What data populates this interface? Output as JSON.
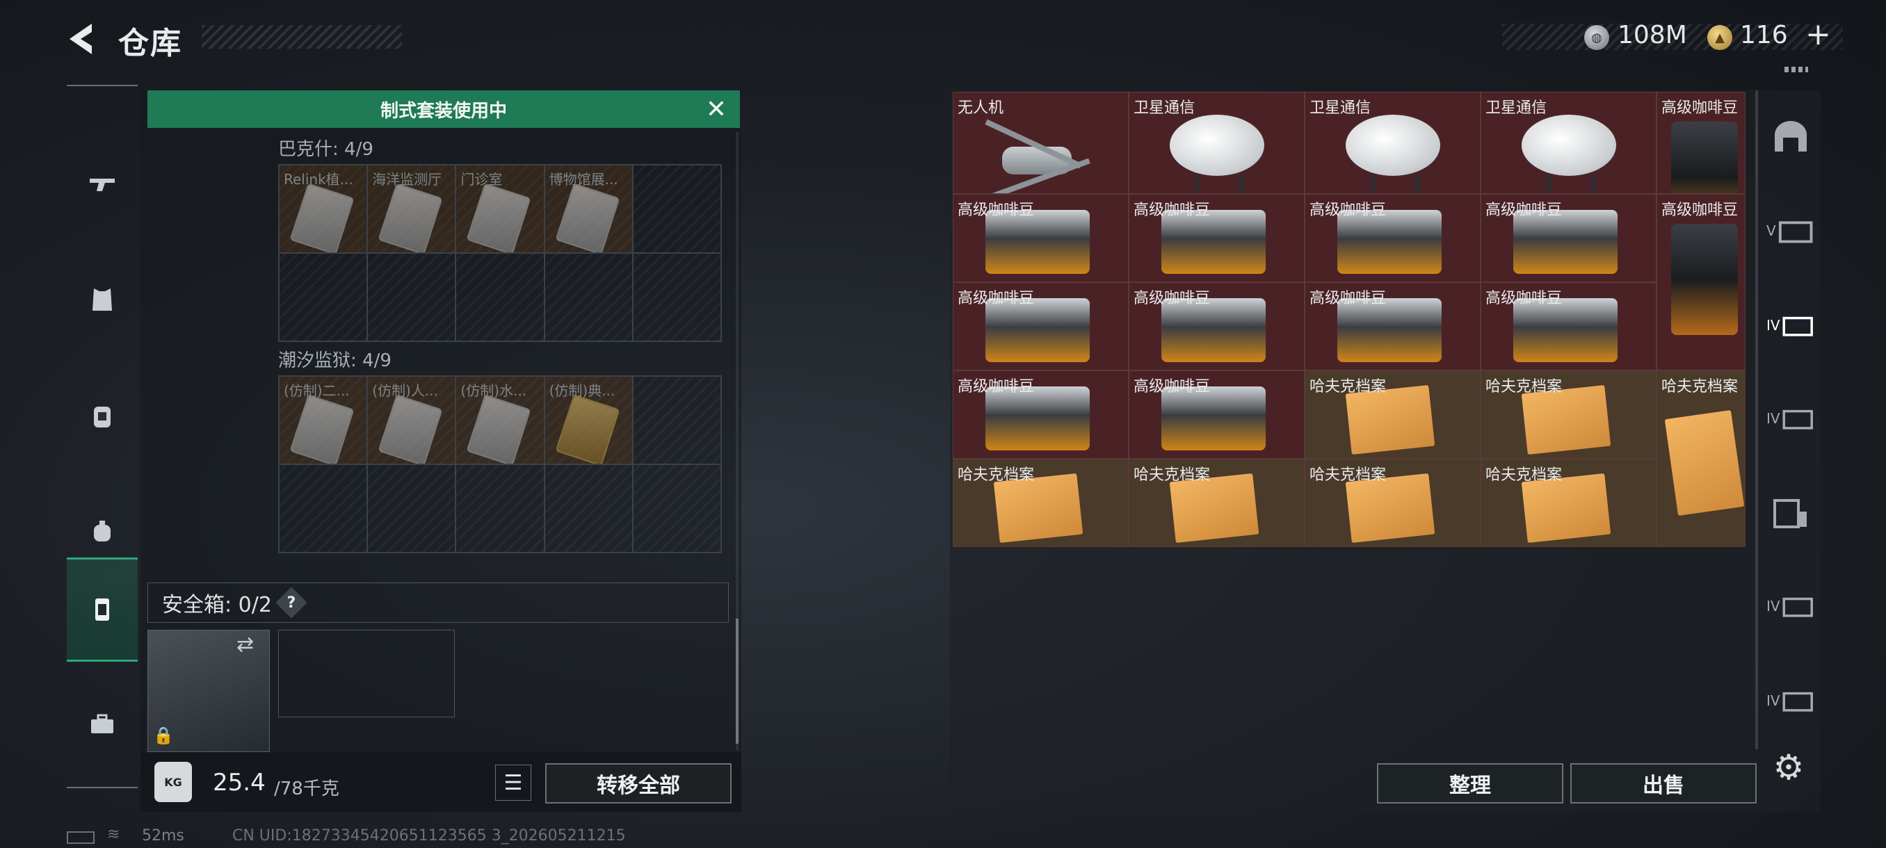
{
  "header": {
    "title": "仓库",
    "coin_value": "108M",
    "token_value": "116",
    "token_plus": "+"
  },
  "banner": {
    "text": "制式套装使用中"
  },
  "sets": [
    {
      "title": "巴克什: 4/9",
      "items": [
        "Relink植...",
        "海洋监测厅",
        "门诊室",
        "博物馆展..."
      ]
    },
    {
      "title": "潮汐监狱: 4/9",
      "items": [
        "(仿制)二...",
        "(仿制)人...",
        "(仿制)水...",
        "(仿制)典..."
      ]
    }
  ],
  "safe_box": {
    "label": "安全箱: 0/2",
    "help": "?"
  },
  "weight": {
    "icon": "KG",
    "current": "25.4",
    "max": "/78千克"
  },
  "buttons": {
    "transfer_all": "转移全部",
    "sort": "整理",
    "sell": "出售"
  },
  "stash_items": [
    {
      "name": "无人机",
      "art": "drone",
      "bg": "red"
    },
    {
      "name": "卫星通信",
      "art": "dish",
      "bg": "red"
    },
    {
      "name": "卫星通信",
      "art": "dish",
      "bg": "red"
    },
    {
      "name": "卫星通信",
      "art": "dish",
      "bg": "red"
    },
    {
      "name": "高级咖啡豆",
      "art": "bag-tall",
      "bg": "red"
    },
    {
      "name": "高级咖啡豆",
      "art": "bag-wide",
      "bg": "red"
    },
    {
      "name": "高级咖啡豆",
      "art": "bag-wide",
      "bg": "red"
    },
    {
      "name": "高级咖啡豆",
      "art": "bag-wide",
      "bg": "red"
    },
    {
      "name": "高级咖啡豆",
      "art": "bag-wide",
      "bg": "red"
    },
    {
      "name": "高级咖啡豆",
      "art": "bag-tall",
      "bg": "red"
    },
    {
      "name": "高级咖啡豆",
      "art": "bag-wide",
      "bg": "red"
    },
    {
      "name": "高级咖啡豆",
      "art": "bag-wide",
      "bg": "red"
    },
    {
      "name": "高级咖啡豆",
      "art": "bag-wide",
      "bg": "red"
    },
    {
      "name": "高级咖啡豆",
      "art": "bag-wide",
      "bg": "red"
    },
    {
      "name": "高级咖啡豆",
      "art": "bag-wide",
      "bg": "red"
    },
    {
      "name": "高级咖啡豆",
      "art": "bag-wide",
      "bg": "red"
    },
    {
      "name": "哈夫克档案",
      "art": "folder",
      "bg": "brown"
    },
    {
      "name": "哈夫克档案",
      "art": "folder",
      "bg": "brown"
    },
    {
      "name": "哈夫克档案",
      "art": "folder-tall",
      "bg": "brown"
    },
    {
      "name": "哈夫克档案",
      "art": "folder",
      "bg": "brown"
    },
    {
      "name": "哈夫克档案",
      "art": "folder",
      "bg": "brown"
    },
    {
      "name": "哈夫克档案",
      "art": "folder",
      "bg": "brown"
    },
    {
      "name": "哈夫克档案",
      "art": "folder",
      "bg": "brown"
    }
  ],
  "right_tabs": [
    "",
    "V",
    "IV",
    "IV",
    "",
    "IV",
    "IV"
  ],
  "footer": {
    "ping": "52ms",
    "uid": "CN UID:18273345420651123565 3_202605211215"
  }
}
